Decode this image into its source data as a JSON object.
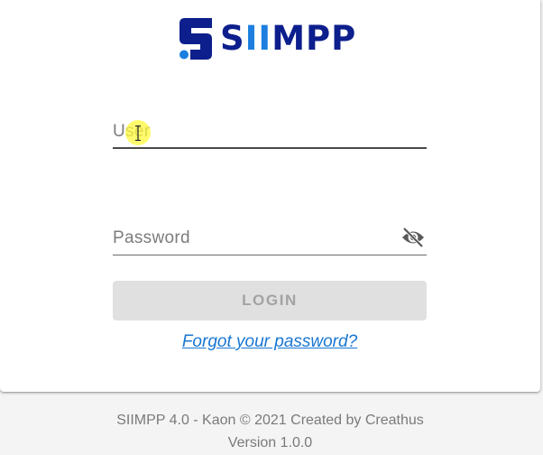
{
  "brand": {
    "logo_text_primary": "S",
    "logo_text_accent": "II",
    "logo_text_tail": "MPP",
    "primary_color": "#0d1f8c",
    "accent_color": "#1c7fe0",
    "logo_icon": "s-logo-icon"
  },
  "login_form": {
    "user_field": {
      "placeholder": "User",
      "value": ""
    },
    "password_field": {
      "placeholder": "Password",
      "value": "",
      "visibility_icon": "eye-off-icon"
    },
    "login_label": "LOGIN",
    "forgot_password_label": "Forgot your password?"
  },
  "footer": {
    "credits": "SIIMPP 4.0 - Kaon © 2021 Created by Creathus",
    "version": "Version 1.0.0"
  }
}
